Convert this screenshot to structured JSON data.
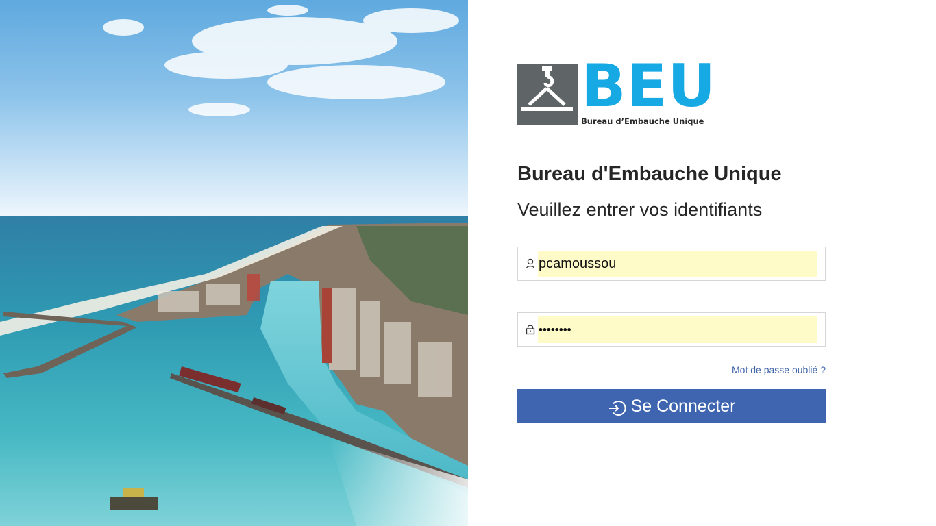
{
  "logo": {
    "letters": "BEU",
    "caption": "Bureau d’Embauche Unique"
  },
  "login": {
    "title": "Bureau d'Embauche Unique",
    "subtitle": "Veuillez entrer vos identifiants",
    "username_value": "pcamoussou",
    "password_value": "••••••••",
    "forgot_label": "Mot de passe oublié ?",
    "submit_label": "Se Connecter"
  },
  "colors": {
    "brand_blue": "#17a9e3",
    "logo_gray": "#5f6466",
    "button_blue": "#3f65b1",
    "link_blue": "#3f63a8",
    "autofill_yellow": "#fffbc9"
  },
  "icons": {
    "username": "user-icon",
    "password": "lock-icon",
    "submit": "login-arrow-icon"
  }
}
